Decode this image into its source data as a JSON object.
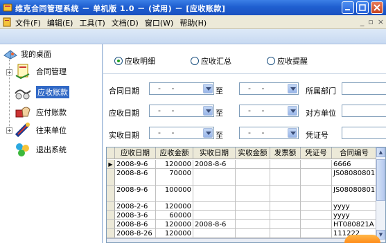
{
  "window": {
    "title": "维克合同管理系统 － 单机版 1.0 － (试用) － [应收账款]",
    "colors": {
      "titlebar": "#1f5fd0",
      "menubar": "#ece9d8",
      "band": "#c7d9f1",
      "selection": "#3169c6"
    }
  },
  "menu": {
    "items": [
      "文件(F)",
      "编辑(E)",
      "工具(T)",
      "文档(D)",
      "窗口(W)",
      "帮助(H)"
    ],
    "mdi_controls": [
      "_",
      "▫",
      "×"
    ]
  },
  "nav": {
    "root": "我的桌面",
    "items": [
      {
        "label": "合同管理",
        "icon": "contract-icon",
        "expandable": true,
        "selected": false
      },
      {
        "label": "应收账款",
        "icon": "receivable-icon",
        "expandable": false,
        "selected": true
      },
      {
        "label": "应付账款",
        "icon": "payable-icon",
        "expandable": false,
        "selected": false
      },
      {
        "label": "往来单位",
        "icon": "partner-icon",
        "expandable": true,
        "selected": false
      },
      {
        "label": "退出系统",
        "icon": "exit-icon",
        "expandable": false,
        "selected": false
      }
    ]
  },
  "tabs": {
    "options": [
      "应收明细",
      "应收汇总",
      "应收提醒"
    ],
    "selected": "应收明细"
  },
  "filters": {
    "row1": {
      "label": "合同日期",
      "from": "-  -",
      "to_label": "至",
      "to": "-  -",
      "right_label": "所属部门"
    },
    "row2": {
      "label": "应收日期",
      "from": "-  -",
      "to_label": "至",
      "to": "-  -",
      "right_label": "对方单位"
    },
    "row3": {
      "label": "实收日期",
      "from": "-  -",
      "to_label": "至",
      "to": "-  -",
      "right_label": "凭证号"
    }
  },
  "grid": {
    "columns": [
      "应收日期",
      "应收金额",
      "实收日期",
      "实收金额",
      "发票额",
      "凭证号",
      "合同编号"
    ],
    "rows": [
      [
        "2008-9-6",
        "120000",
        "2008-8-6",
        "",
        "",
        "",
        "6666"
      ],
      [
        "2008-8-6",
        "70000",
        "",
        "",
        "",
        "",
        "JS08080801"
      ],
      [
        "2008-9-6",
        "100000",
        "",
        "",
        "",
        "",
        "JS08080801"
      ],
      [
        "2008-2-6",
        "120000",
        "",
        "",
        "",
        "",
        "yyyy"
      ],
      [
        "2008-3-6",
        "60000",
        "",
        "",
        "",
        "",
        "yyyy"
      ],
      [
        "2008-8-6",
        "120000",
        "2008-8-6",
        "",
        "",
        "",
        "HT080821A"
      ],
      [
        "2008-8-26",
        "120000",
        "",
        "",
        "",
        "",
        "111222"
      ]
    ]
  }
}
